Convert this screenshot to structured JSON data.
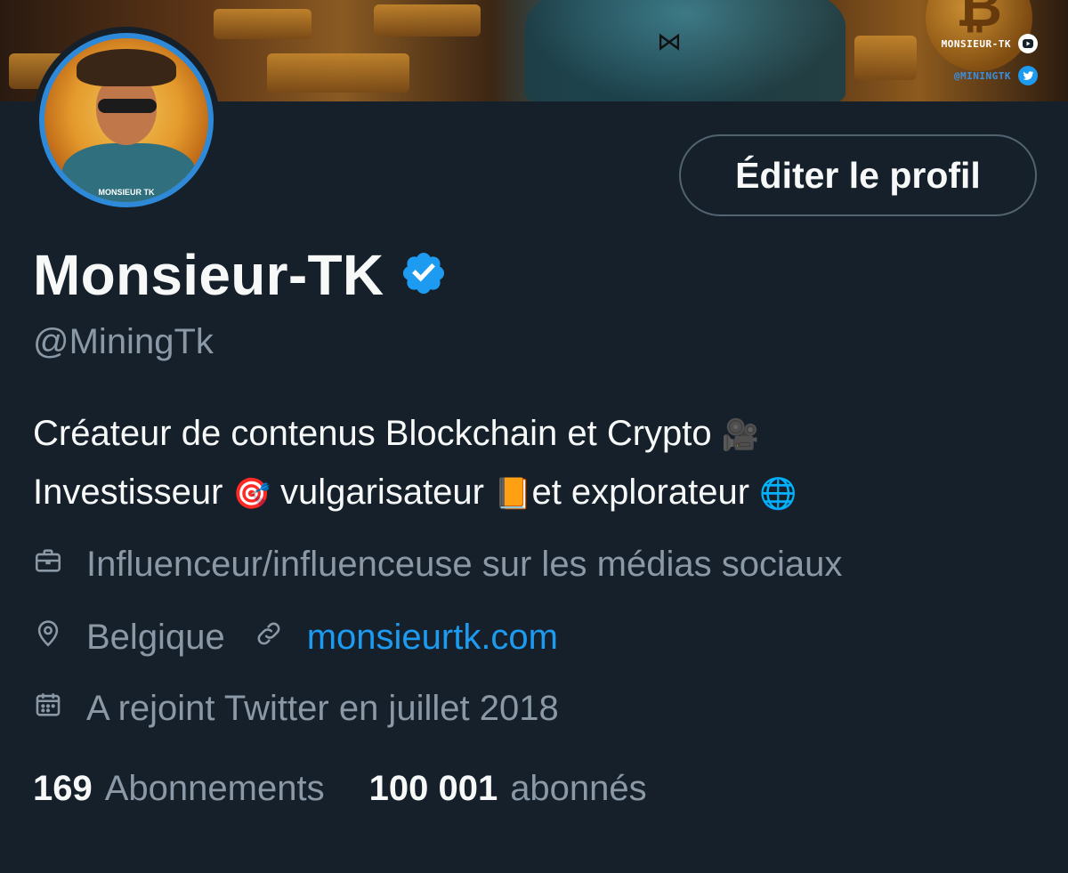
{
  "banner": {
    "youtube_tag": "MONSIEUR-TK",
    "twitter_tag": "@MININGTK",
    "coin_symbol": "₿"
  },
  "avatar": {
    "ring_text": "MONSIEUR TK"
  },
  "profile": {
    "edit_button_label": "Éditer le profil",
    "display_name": "Monsieur-TK",
    "handle": "@MiningTk",
    "bio_line1": "Créateur de contenus Blockchain et Crypto ",
    "bio_line2_a": "Investisseur ",
    "bio_line2_b": " vulgarisateur ",
    "bio_line2_c": "et explorateur ",
    "category": "Influenceur/influenceuse sur les médias sociaux",
    "location": "Belgique",
    "website": "monsieurtk.com",
    "joined": "A rejoint Twitter en juillet 2018"
  },
  "stats": {
    "following_count": "169",
    "following_label": "Abonnements",
    "followers_count": "100 001",
    "followers_label": "abonnés"
  },
  "icons": {
    "verified": "verified-badge-icon",
    "category": "briefcase-icon",
    "location": "location-pin-icon",
    "link": "link-icon",
    "joined": "calendar-icon"
  },
  "colors": {
    "background": "#15202b",
    "accent": "#1d9bf0",
    "secondary_text": "#8b98a5",
    "primary_text": "#f7f9f9"
  }
}
